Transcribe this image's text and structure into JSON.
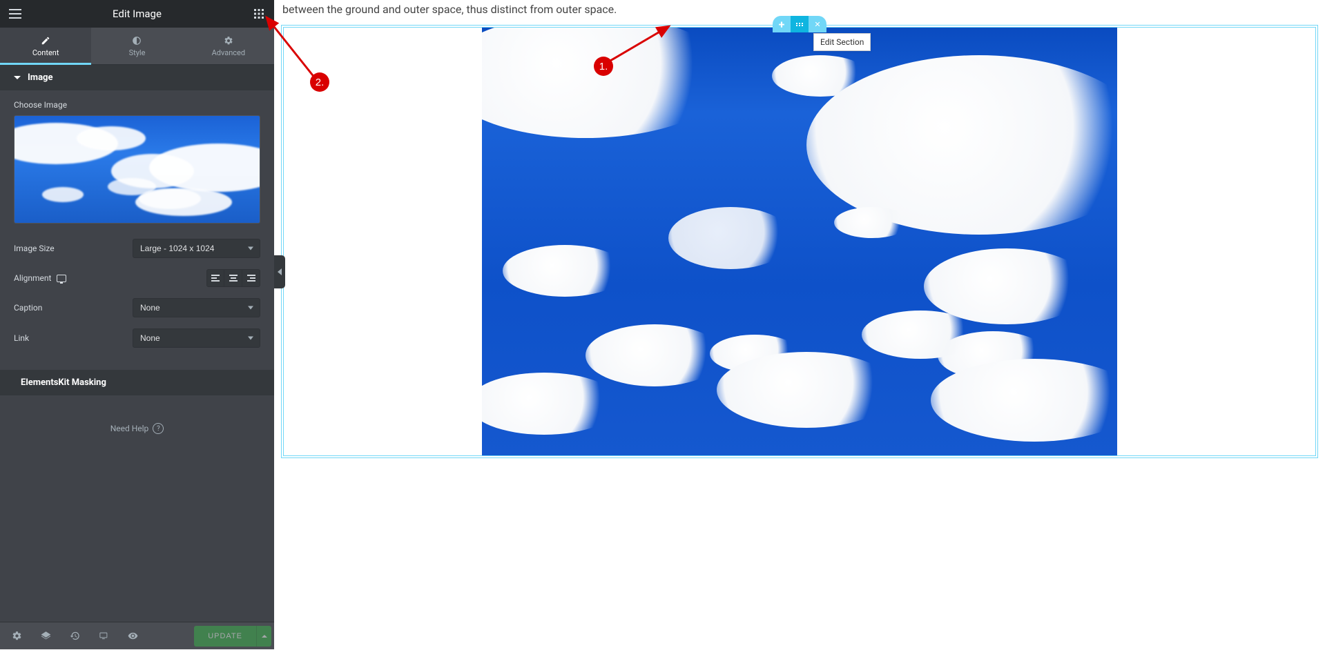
{
  "panel": {
    "title": "Edit Image",
    "tabs": {
      "content": "Content",
      "style": "Style",
      "advanced": "Advanced"
    },
    "section_image": "Image",
    "choose_image": "Choose Image",
    "image_size_label": "Image Size",
    "image_size_value": "Large - 1024 x 1024",
    "alignment_label": "Alignment",
    "caption_label": "Caption",
    "caption_value": "None",
    "link_label": "Link",
    "link_value": "None",
    "masking_section": "ElementsKit Masking",
    "help": "Need Help",
    "update_btn": "UPDATE"
  },
  "canvas": {
    "body_text": "between the ground and outer space, thus distinct from outer space.",
    "tooltip": "Edit Section"
  },
  "annotations": {
    "badge1": "1.",
    "badge2": "2."
  }
}
